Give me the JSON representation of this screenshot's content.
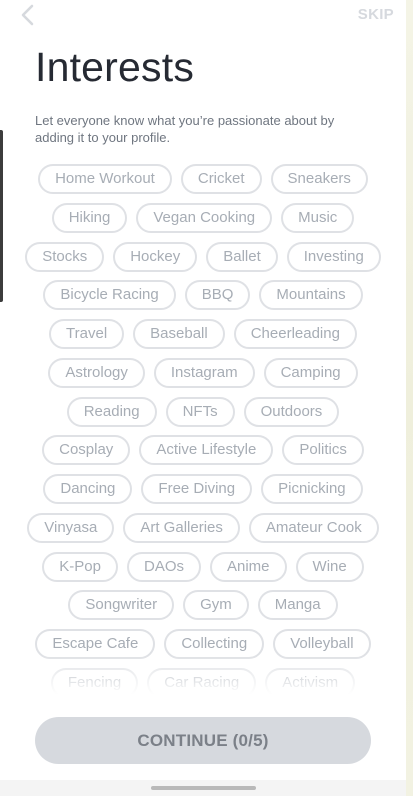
{
  "header": {
    "back_icon": "chevron-left-icon",
    "skip_label": "SKIP"
  },
  "title": "Interests",
  "subtitle": "Let everyone know what you’re passionate about by adding it to your profile.",
  "interests_rows": [
    [
      "Home Workout",
      "Cricket",
      "Sneakers"
    ],
    [
      "Hiking",
      "Vegan Cooking",
      "Music"
    ],
    [
      "Stocks",
      "Hockey",
      "Ballet",
      "Investing"
    ],
    [
      "Bicycle Racing",
      "BBQ",
      "Mountains"
    ],
    [
      "Travel",
      "Baseball",
      "Cheerleading"
    ],
    [
      "Astrology",
      "Instagram",
      "Camping"
    ],
    [
      "Reading",
      "NFTs",
      "Outdoors"
    ],
    [
      "Cosplay",
      "Active Lifestyle",
      "Politics"
    ],
    [
      "Dancing",
      "Free Diving",
      "Picnicking"
    ],
    [
      "Vinyasa",
      "Art Galleries",
      "Amateur Cook"
    ],
    [
      "K-Pop",
      "DAOs",
      "Anime",
      "Wine"
    ],
    [
      "Songwriter",
      "Gym",
      "Manga"
    ],
    [
      "Escape Cafe",
      "Collecting",
      "Volleyball"
    ],
    [
      "Fencing",
      "Car Racing",
      "Activism"
    ]
  ],
  "continue_label": "CONTINUE (0/5)",
  "colors": {
    "title": "#262a33",
    "chip_border": "#dfe1e5",
    "chip_text": "#a7adb5",
    "button_bg": "#d6d9de",
    "button_text": "#7b8088"
  }
}
